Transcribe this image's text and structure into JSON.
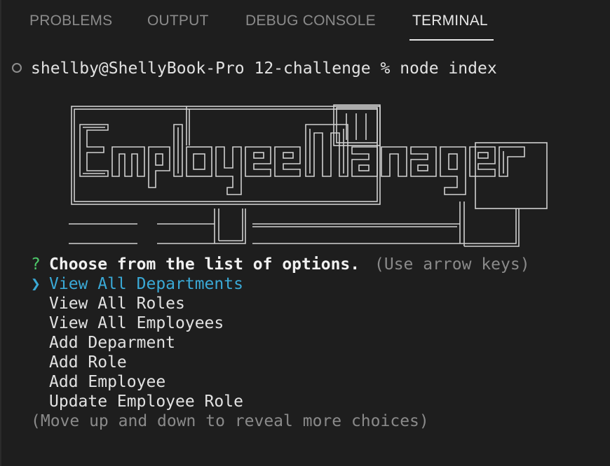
{
  "tabs": [
    {
      "label": "PROBLEMS",
      "active": false
    },
    {
      "label": "OUTPUT",
      "active": false
    },
    {
      "label": "DEBUG CONSOLE",
      "active": false
    },
    {
      "label": "TERMINAL",
      "active": true
    }
  ],
  "terminal": {
    "prompt_line": "shellby@ShellyBook-Pro 12-challenge % node index",
    "banner_text": "Employee Manager",
    "question_marker": "?",
    "question": "Choose from the list of options.",
    "hint": "(Use arrow keys)",
    "pointer": "❯",
    "options": [
      {
        "label": "View All Departments",
        "selected": true
      },
      {
        "label": "View All Roles",
        "selected": false
      },
      {
        "label": "View All Employees",
        "selected": false
      },
      {
        "label": "Add Deparment",
        "selected": false
      },
      {
        "label": "Add Role",
        "selected": false
      },
      {
        "label": "Add Employee",
        "selected": false
      },
      {
        "label": "Update Employee Role",
        "selected": false
      }
    ],
    "footer": "(Move up and down to reveal more choices)"
  },
  "colors": {
    "background": "#1e1e1e",
    "accent": "#3aa9d6",
    "question_mark": "#4ec96a",
    "dim": "#8a8a8a"
  }
}
